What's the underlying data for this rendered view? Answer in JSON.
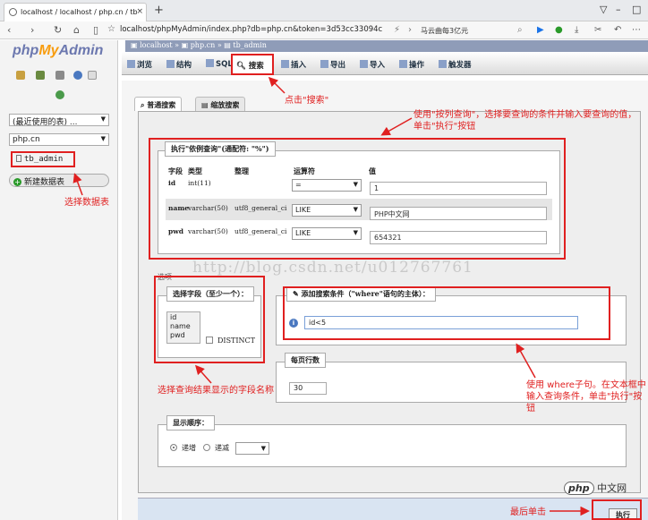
{
  "browser": {
    "tab_title": "localhost / localhost / php.cn / tb",
    "tab_close": "×",
    "new_tab": "+",
    "url": "localhost/phpMyAdmin/index.php?db=php.cn&token=3d53cc33094c",
    "ad_text": "马云曲每3亿元",
    "window_controls": [
      "▽",
      "–",
      "□"
    ]
  },
  "sidebar": {
    "logo": {
      "php": "php",
      "my": "My",
      "admin": "Admin"
    },
    "recent_tables": "(最近使用的表) ...",
    "database": "php.cn",
    "table_item": "tb_admin",
    "new_db": "新建数据表"
  },
  "breadcrumb": [
    "localhost",
    "php.cn",
    "tb_admin"
  ],
  "tabs": [
    "浏览",
    "结构",
    "SQL",
    "搜索",
    "插入",
    "导出",
    "导入",
    "操作",
    "触发器"
  ],
  "subtabs": [
    "普通搜索",
    "缩放搜索"
  ],
  "query_legend": "执行\"依例查询\"(通配符: \"%\")",
  "columns": {
    "field": "字段",
    "type": "类型",
    "collation": "整理",
    "operator": "运算符",
    "value": "值"
  },
  "rows": [
    {
      "field": "id",
      "type": "int(11)",
      "collation": "",
      "operator": "=",
      "value": "1"
    },
    {
      "field": "name",
      "type": "varchar(50)",
      "collation": "utf8_general_ci",
      "operator": "LIKE",
      "value": "PHP中文网"
    },
    {
      "field": "pwd",
      "type": "varchar(50)",
      "collation": "utf8_general_ci",
      "operator": "LIKE",
      "value": "654321"
    }
  ],
  "options_label": "选项",
  "select_fields_legend": "选择字段（至少一个）：",
  "field_options": [
    "id",
    "name",
    "pwd"
  ],
  "distinct": "DISTINCT",
  "where_legend": "添加搜索条件（\"where\"语句的主体）：",
  "where_value": "id<5",
  "rows_per_page_legend": "每页行数",
  "rows_per_page": "30",
  "order_legend": "显示顺序：",
  "order_asc": "递增",
  "order_desc": "递减",
  "execute": "执行",
  "watermark": "http://blog.csdn.net/u012767761",
  "badge": {
    "pill": "php",
    "text": "中文网"
  },
  "annotations": {
    "click_search": "点击\"搜索\"",
    "by_column": "使用\"按列查询\"，选择要查询的条件并输入要查询的值，单击\"执行\"按钮",
    "select_table": "选择数据表",
    "select_fields": "选择查询结果显示的字段名称",
    "where_hint": "使用 where子句。在文本框中输入查询条件，单击\"执行\"按钮",
    "last_click": "最后单击"
  }
}
